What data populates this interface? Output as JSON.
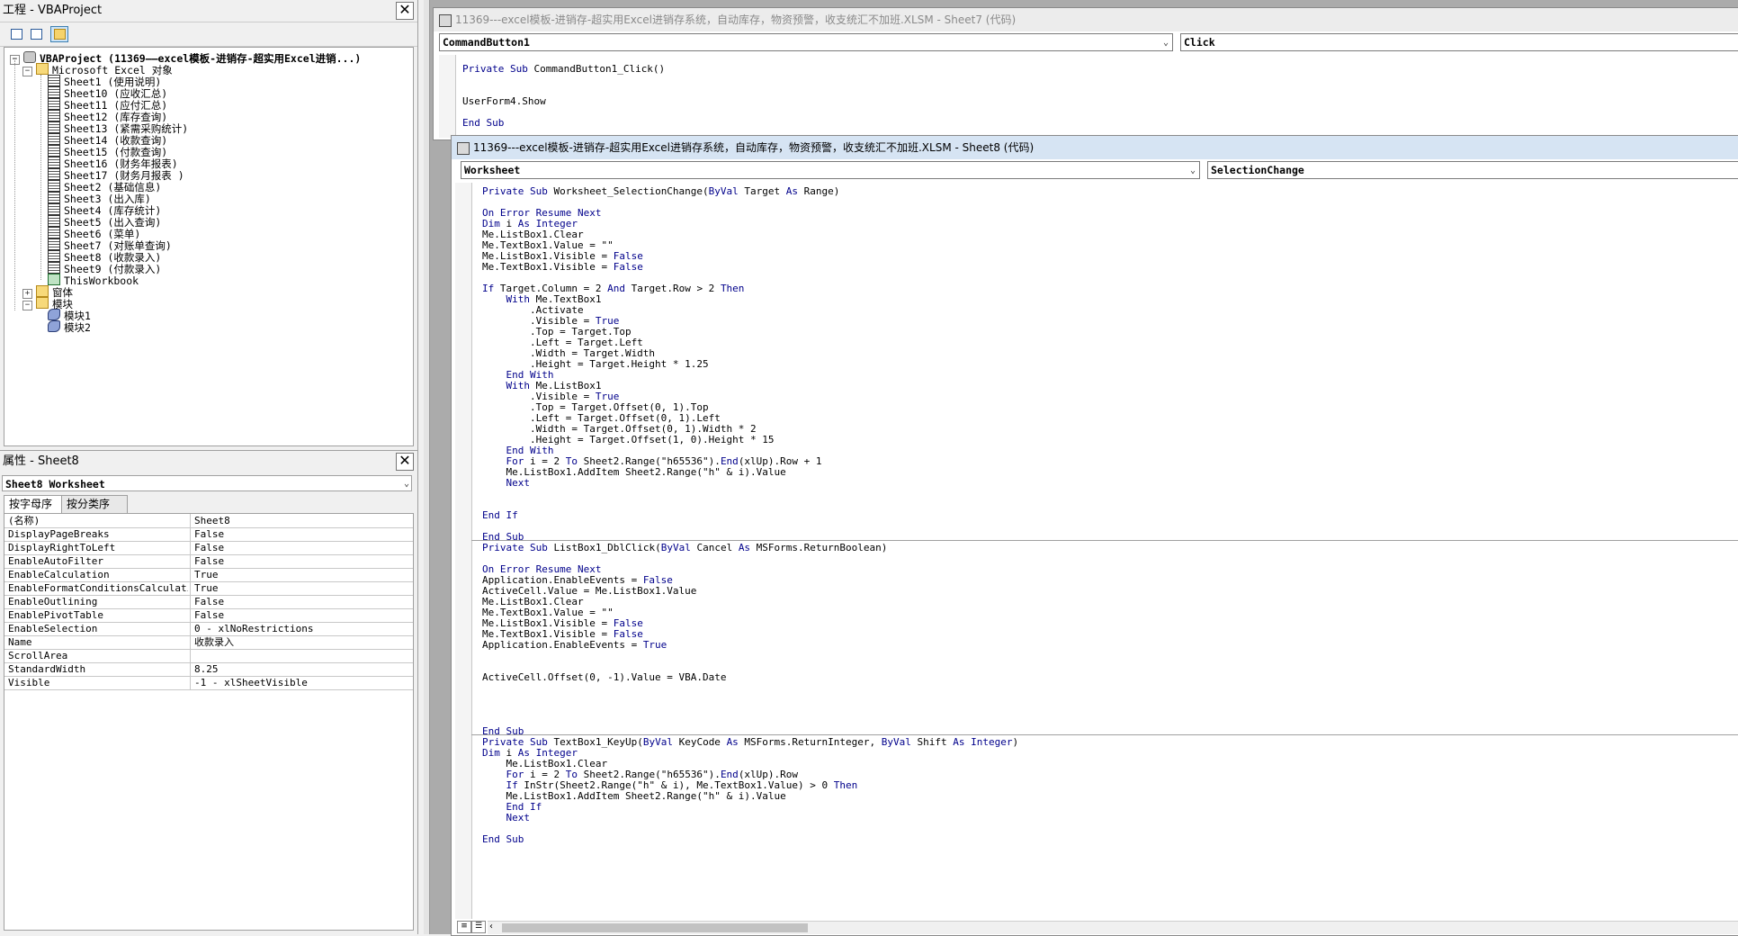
{
  "project_panel": {
    "title": "工程 - VBAProject",
    "close": "✕",
    "tree": {
      "root": "VBAProject (11369——excel模板-进销存-超实用Excel进销...)",
      "excel_objects_label": "Microsoft Excel 对象",
      "sheets": [
        "Sheet1 (使用说明)",
        "Sheet10 (应收汇总)",
        "Sheet11 (应付汇总)",
        "Sheet12 (库存查询)",
        "Sheet13 (紧需采购统计)",
        "Sheet14 (收款查询)",
        "Sheet15 (付款查询)",
        "Sheet16 (财务年报表)",
        "Sheet17 (财务月报表 )",
        "Sheet2 (基础信息)",
        "Sheet3 (出入库)",
        "Sheet4 (库存统计)",
        "Sheet5 (出入查询)",
        "Sheet6 (菜单)",
        "Sheet7 (对账单查询)",
        "Sheet8 (收款录入)",
        "Sheet9 (付款录入)"
      ],
      "workbook": "ThisWorkbook",
      "forms_label": "窗体",
      "modules_label": "模块",
      "modules": [
        "模块1",
        "模块2"
      ],
      "expanded": "⊟",
      "collapsed": "⊞"
    }
  },
  "properties_panel": {
    "title": "属性 - Sheet8",
    "close": "✕",
    "object_selector": "Sheet8 Worksheet",
    "tabs": [
      "按字母序",
      "按分类序"
    ],
    "rows": [
      {
        "name": "(名称)",
        "value": "Sheet8"
      },
      {
        "name": "DisplayPageBreaks",
        "value": "False"
      },
      {
        "name": "DisplayRightToLeft",
        "value": "False"
      },
      {
        "name": "EnableAutoFilter",
        "value": "False"
      },
      {
        "name": "EnableCalculation",
        "value": "True"
      },
      {
        "name": "EnableFormatConditionsCalculation",
        "value": "True"
      },
      {
        "name": "EnableOutlining",
        "value": "False"
      },
      {
        "name": "EnablePivotTable",
        "value": "False"
      },
      {
        "name": "EnableSelection",
        "value": "0 - xlNoRestrictions"
      },
      {
        "name": "Name",
        "value": "收款录入"
      },
      {
        "name": "ScrollArea",
        "value": ""
      },
      {
        "name": "StandardWidth",
        "value": "8.25"
      },
      {
        "name": "Visible",
        "value": "-1 - xlSheetVisible"
      }
    ]
  },
  "code_window_back": {
    "title": "11369---excel模板-进销存-超实用Excel进销存系统，自动库存，物资预警，收支统汇不加班.XLSM - Sheet7 (代码)",
    "object_dropdown": "CommandButton1",
    "proc_dropdown": "Click",
    "lines": [
      "Private Sub CommandButton1_Click()",
      "",
      "",
      "UserForm4.Show",
      "",
      "End Sub"
    ]
  },
  "code_window_front": {
    "title": "11369---excel模板-进销存-超实用Excel进销存系统，自动库存，物资预警，收支统汇不加班.XLSM - Sheet8 (代码)",
    "object_dropdown": "Worksheet",
    "proc_dropdown": "SelectionChange",
    "lines": [
      "Private Sub Worksheet_SelectionChange(ByVal Target As Range)",
      "",
      "On Error Resume Next",
      "Dim i As Integer",
      "Me.ListBox1.Clear",
      "Me.TextBox1.Value = \"\"",
      "Me.ListBox1.Visible = False",
      "Me.TextBox1.Visible = False",
      "",
      "If Target.Column = 2 And Target.Row > 2 Then",
      "    With Me.TextBox1",
      "        .Activate",
      "        .Visible = True",
      "        .Top = Target.Top",
      "        .Left = Target.Left",
      "        .Width = Target.Width",
      "        .Height = Target.Height * 1.25",
      "    End With",
      "    With Me.ListBox1",
      "        .Visible = True",
      "        .Top = Target.Offset(0, 1).Top",
      "        .Left = Target.Offset(0, 1).Left",
      "        .Width = Target.Offset(0, 1).Width * 2",
      "        .Height = Target.Offset(1, 0).Height * 15",
      "    End With",
      "    For i = 2 To Sheet2.Range(\"h65536\").End(xlUp).Row + 1",
      "    Me.ListBox1.AddItem Sheet2.Range(\"h\" & i).Value",
      "    Next",
      "",
      "",
      "End If",
      "",
      "End Sub",
      "Private Sub ListBox1_DblClick(ByVal Cancel As MSForms.ReturnBoolean)",
      "",
      "On Error Resume Next",
      "Application.EnableEvents = False",
      "ActiveCell.Value = Me.ListBox1.Value",
      "Me.ListBox1.Clear",
      "Me.TextBox1.Value = \"\"",
      "Me.ListBox1.Visible = False",
      "Me.TextBox1.Visible = False",
      "Application.EnableEvents = True",
      "",
      "",
      "ActiveCell.Offset(0, -1).Value = VBA.Date",
      "",
      "",
      "",
      "",
      "End Sub",
      "Private Sub TextBox1_KeyUp(ByVal KeyCode As MSForms.ReturnInteger, ByVal Shift As Integer)",
      "Dim i As Integer",
      "    Me.ListBox1.Clear",
      "    For i = 2 To Sheet2.Range(\"h65536\").End(xlUp).Row",
      "    If InStr(Sheet2.Range(\"h\" & i), Me.TextBox1.Value) > 0 Then",
      "    Me.ListBox1.AddItem Sheet2.Range(\"h\" & i).Value",
      "    End If",
      "    Next",
      "",
      "End Sub"
    ]
  },
  "colors": {
    "keyword": "#00008b",
    "title_active": "#d6e4f3",
    "title_inactive": "#ececec",
    "mdi_background": "#ababab"
  }
}
